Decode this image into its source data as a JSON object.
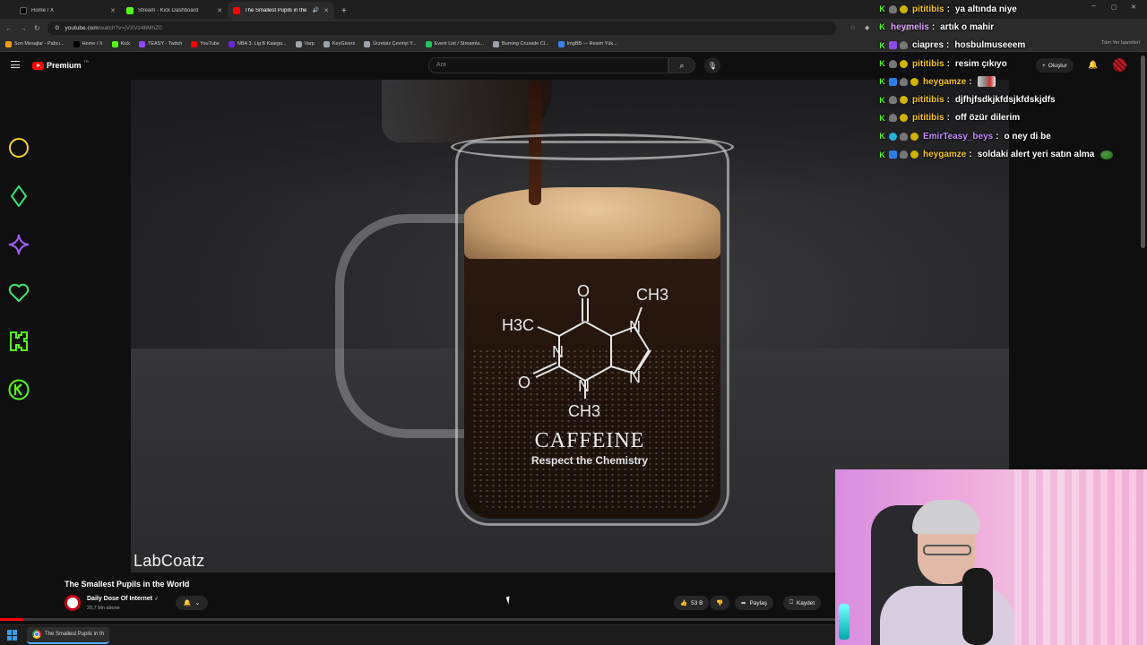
{
  "browser": {
    "tabs": [
      {
        "title": "Home / X",
        "favicon_color": "#000000",
        "active": false
      },
      {
        "title": "Stream - Kick Dashboard",
        "favicon_color": "#53fc18",
        "active": false
      },
      {
        "title": "The Smallest Pupils in the W",
        "favicon_color": "#ff0000",
        "active": true
      }
    ],
    "new_tab_label": "+",
    "url_host": "youtube.com",
    "url_path": "/watch?v=jVXVz46MhZ0",
    "bookmarks": [
      {
        "label": "Son Mesajlar - Pabcı...",
        "color": "#f59e0b"
      },
      {
        "label": "Home / X",
        "color": "#000000"
      },
      {
        "label": "Kick",
        "color": "#53fc18"
      },
      {
        "label": "TEASY - Twitch",
        "color": "#9146ff"
      },
      {
        "label": "YouTube",
        "color": "#ff0000"
      },
      {
        "label": "NBA 3. Lig B Katego...",
        "color": "#6d28d9"
      },
      {
        "label": "Varp",
        "color": "#9ca3af"
      },
      {
        "label": "KeyGivers",
        "color": "#9ca3af"
      },
      {
        "label": "Ücretsiz Çeviriyi Y...",
        "color": "#9ca3af"
      },
      {
        "label": "Event List / Streamla...",
        "color": "#22c55e"
      },
      {
        "label": "Burning Crusade Cl...",
        "color": "#9ca3af"
      },
      {
        "label": "ImgBB — Resim Yük...",
        "color": "#3b82f6"
      }
    ],
    "bookmarks_right": "Tüm Yer İşaretleri"
  },
  "youtube": {
    "brand": "Premium",
    "region": "TR",
    "search_placeholder": "Ara",
    "create_label": "Oluştur",
    "video": {
      "watermark": "LabCoatz",
      "mug_word": "CAFFEINE",
      "mug_subtitle": "Respect the Chemistry",
      "molecule": {
        "o_top": "O",
        "ch3_top": "CH3",
        "h3c": "H3C",
        "n_left": "N",
        "n_right_top": "N",
        "n_right_bottom": "N",
        "o_left": "O",
        "n_bottom": "N",
        "ch3_bottom": "CH3"
      },
      "progress": 0.02
    },
    "title": "The Smallest Pupils in the World",
    "channel": {
      "name": "Daily Dose Of Internet",
      "verified": "✓",
      "subscribers": "20,7 Mn abone"
    },
    "actions": {
      "likes": "53 B",
      "share": "Paylaş",
      "save": "Kaydet"
    }
  },
  "alerts_icons": [
    "circle-icon",
    "diamond-icon",
    "sparkle-icon",
    "heart-icon",
    "kick-icon",
    "kick-coin-icon"
  ],
  "chat": [
    {
      "user": "pititibis",
      "color": "#f5c518",
      "message": "ya altında niye",
      "badges": [
        "k",
        "shield",
        "gem"
      ]
    },
    {
      "user": "heymelis",
      "color": "#e2a8ff",
      "message": "artık o mahir",
      "badges": [
        "k"
      ]
    },
    {
      "user": "ciapres",
      "color": "#ffffff",
      "message": "hosbulmuseeem",
      "badges": [
        "k",
        "purple",
        "shield"
      ]
    },
    {
      "user": "pititibis",
      "color": "#f5c518",
      "message": "resim çıkıyo",
      "badges": [
        "k",
        "shield",
        "gem"
      ]
    },
    {
      "user": "heygamze",
      "color": "#f5c518",
      "message": "",
      "badges": [
        "k",
        "blue",
        "shield",
        "gem"
      ],
      "emote": true
    },
    {
      "user": "pititibis",
      "color": "#f5c518",
      "message": "djfhjfsdkjkfdsjkfdskjdfs",
      "badges": [
        "k",
        "shield",
        "gem"
      ]
    },
    {
      "user": "pititibis",
      "color": "#f5c518",
      "message": "off özür dilerim",
      "badges": [
        "k",
        "shield",
        "gem"
      ]
    },
    {
      "user": "EmirTeasy_beys",
      "color": "#c58bff",
      "message": "o ney di be",
      "badges": [
        "k",
        "cyan",
        "shield",
        "gem"
      ]
    },
    {
      "user": "heygamze",
      "color": "#f5c518",
      "message": "soldaki alert yeri satın alma",
      "badges": [
        "k",
        "blue",
        "shield",
        "gem"
      ],
      "pepe": true
    }
  ],
  "taskbar": {
    "item_title": "The Smallest Pupils in th"
  }
}
